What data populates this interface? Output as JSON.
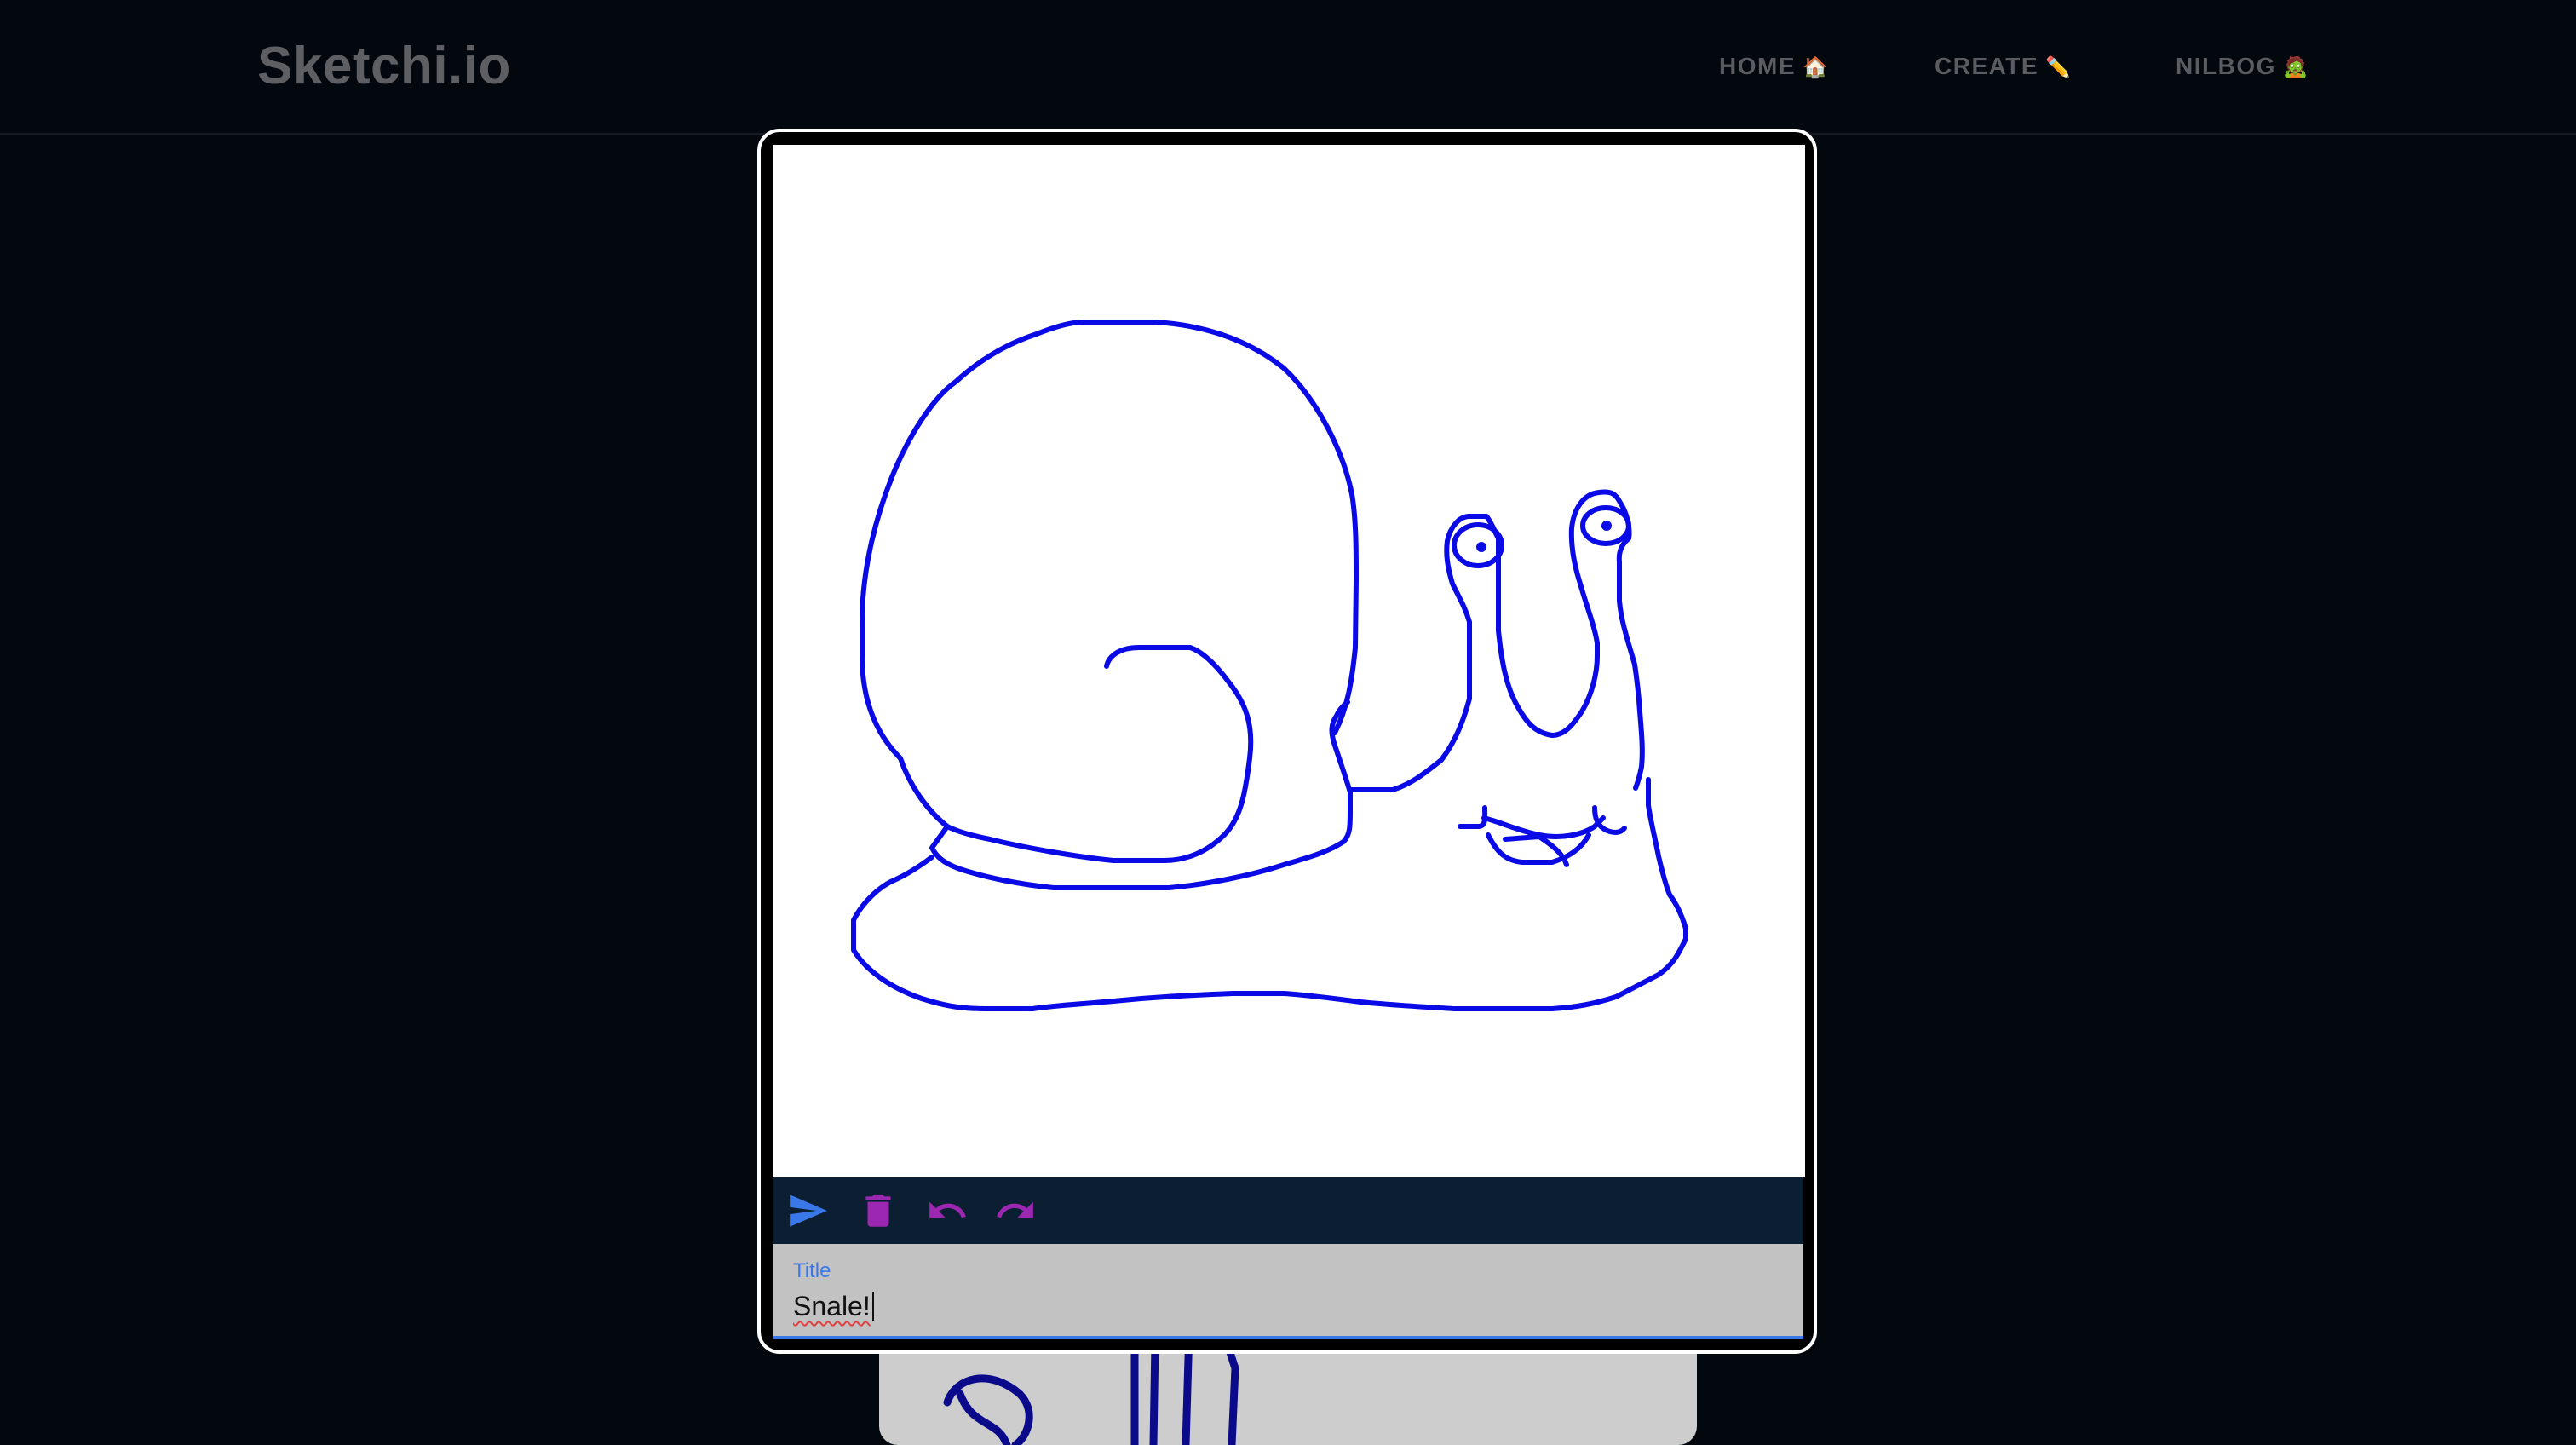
{
  "app": {
    "logo": "Sketchi.io"
  },
  "nav": {
    "home_label": "HOME",
    "home_emoji": "🏠",
    "create_label": "CREATE",
    "create_emoji": "✏️",
    "nilbog_label": "NILBOG",
    "nilbog_emoji": "🧟"
  },
  "editor": {
    "toolbar": {
      "submit_icon": "send-icon",
      "delete_icon": "trash-icon",
      "undo_icon": "undo-icon",
      "redo_icon": "redo-icon"
    },
    "title_field": {
      "label": "Title",
      "value": "Snale!"
    },
    "stroke_color": "#0a0ae6"
  },
  "colors": {
    "background": "#03080e",
    "toolbar": "#0c1e32",
    "accent_blue": "#3b78e7",
    "accent_purple": "#9c27b0"
  }
}
